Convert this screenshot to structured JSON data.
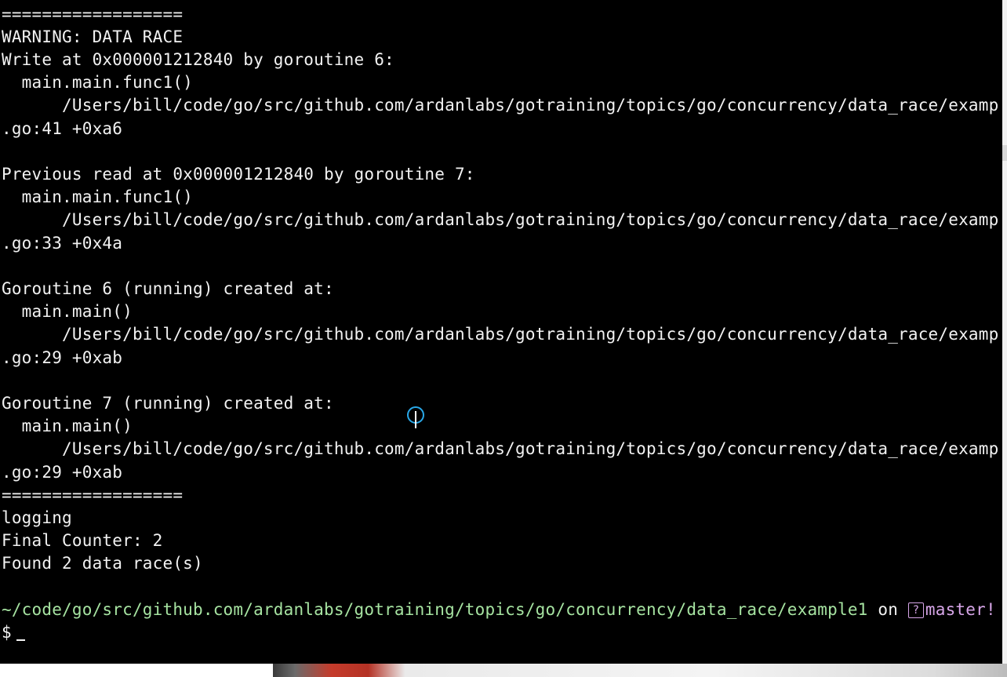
{
  "terminal": {
    "lines": [
      "==================",
      "WARNING: DATA RACE",
      "Write at 0x000001212840 by goroutine 6:",
      "  main.main.func1()",
      "      /Users/bill/code/go/src/github.com/ardanlabs/gotraining/topics/go/concurrency/data_race/examp",
      ".go:41 +0xa6",
      "",
      "Previous read at 0x000001212840 by goroutine 7:",
      "  main.main.func1()",
      "      /Users/bill/code/go/src/github.com/ardanlabs/gotraining/topics/go/concurrency/data_race/examp",
      ".go:33 +0x4a",
      "",
      "Goroutine 6 (running) created at:",
      "  main.main()",
      "      /Users/bill/code/go/src/github.com/ardanlabs/gotraining/topics/go/concurrency/data_race/examp",
      ".go:29 +0xab",
      "",
      "Goroutine 7 (running) created at:",
      "  main.main()",
      "      /Users/bill/code/go/src/github.com/ardanlabs/gotraining/topics/go/concurrency/data_race/examp",
      ".go:29 +0xab",
      "==================",
      "logging",
      "Final Counter: 2",
      "Found 2 data race(s)",
      ""
    ],
    "prompt": {
      "path": "~/code/go/src/github.com/ardanlabs/gotraining/topics/go/concurrency/data_race/example1",
      "on_text": " on ",
      "branch_icon": "?",
      "branch": "master!",
      "symbol": "$"
    },
    "colors": {
      "background": "#000000",
      "text": "#f2f2f2",
      "path": "#a6e3a1",
      "branch": "#d7a6e8",
      "cursor_ring": "#29a8e8"
    }
  }
}
